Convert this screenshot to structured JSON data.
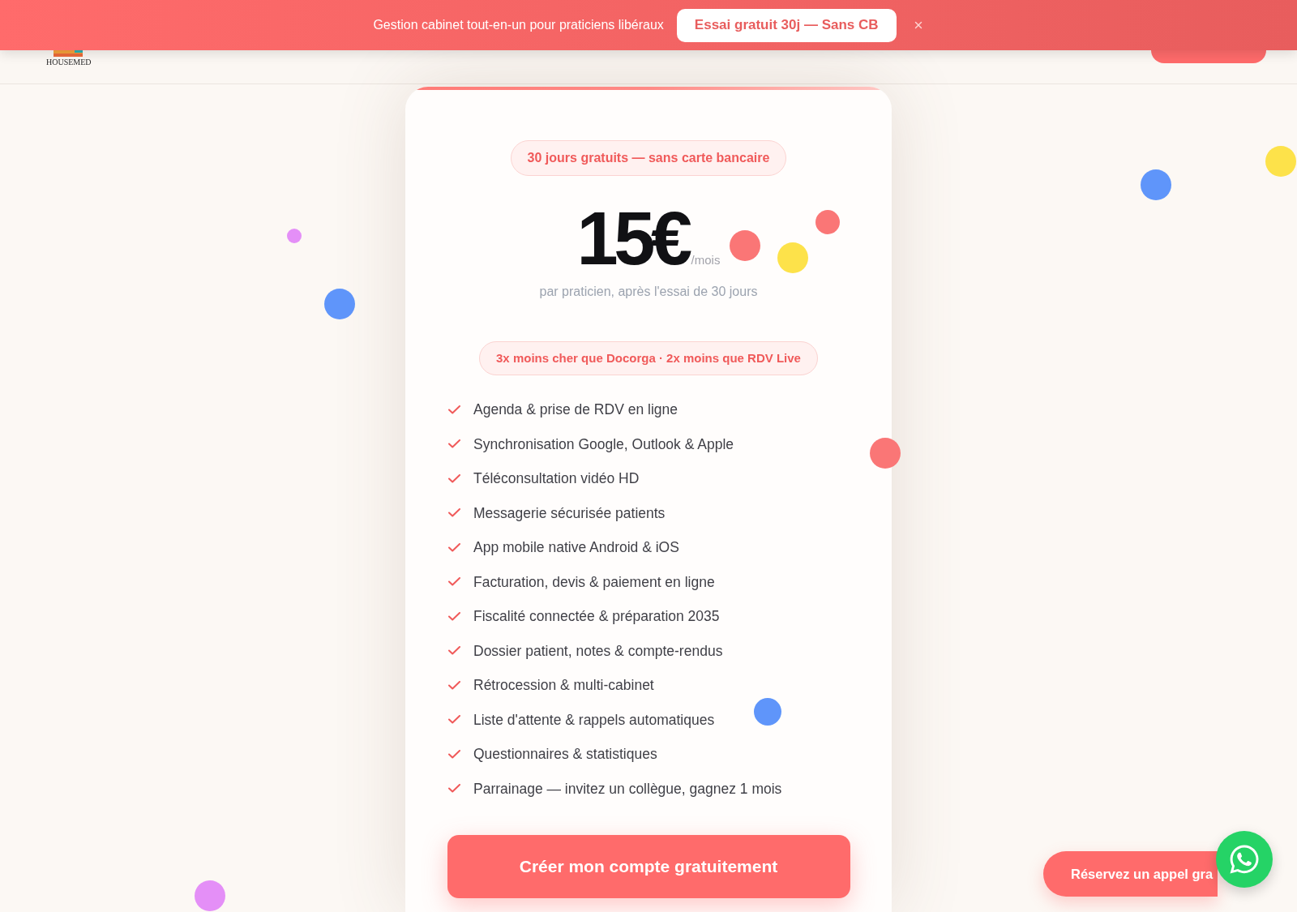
{
  "banner": {
    "text": "Gestion cabinet tout-en-un pour praticiens libéraux",
    "button": "Essai gratuit 30j — Sans CB"
  },
  "header": {
    "logo_text": "HOUSEMED"
  },
  "pricing_card": {
    "badge": "30 jours gratuits — sans carte bancaire",
    "price": "15€",
    "period": "/mois",
    "subtitle": "par praticien, après l'essai de 30 jours",
    "comparison": "3x moins cher que Docorga · 2x moins que RDV Live",
    "features": [
      "Agenda & prise de RDV en ligne",
      "Synchronisation Google, Outlook & Apple",
      "Téléconsultation vidéo HD",
      "Messagerie sécurisée patients",
      "App mobile native Android & iOS",
      "Facturation, devis & paiement en ligne",
      "Fiscalité connectée & préparation 2035",
      "Dossier patient, notes & compte-rendus",
      "Rétrocession & multi-cabinet",
      "Liste d'attente & rappels automatiques",
      "Questionnaires & statistiques",
      "Parrainage — invitez un collègue, gagnez 1 mois"
    ],
    "cta": "Créer mon compte gratuitement"
  },
  "floating": {
    "call_button": "Réservez un appel gra"
  },
  "confetti": [
    {
      "color": "#e48ff7"
    },
    {
      "color": "#5f95fa"
    },
    {
      "color": "#fa7676"
    },
    {
      "color": "#fde24a"
    },
    {
      "color": "#fa7676"
    },
    {
      "color": "#5f95fa"
    },
    {
      "color": "#fde24a"
    },
    {
      "color": "#fa7676"
    },
    {
      "color": "#5f95fa"
    },
    {
      "color": "#e48ff7"
    }
  ]
}
